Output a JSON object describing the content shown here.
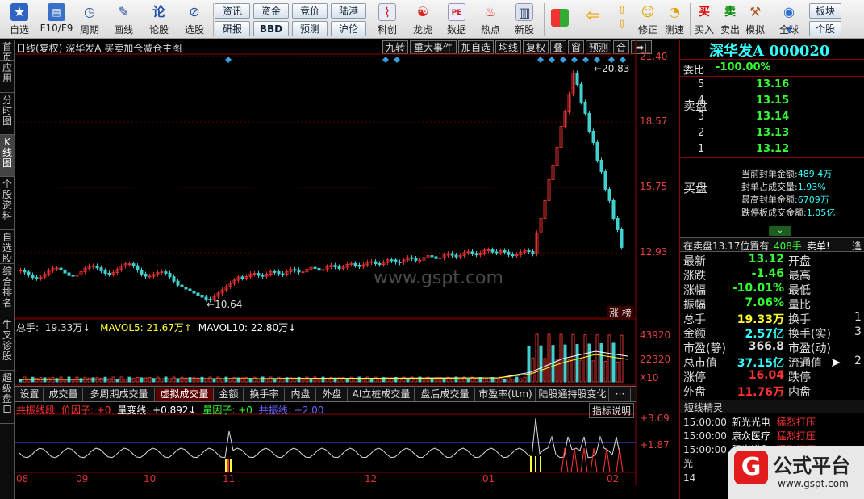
{
  "toolbar": {
    "buttons": [
      {
        "label": "自选",
        "icon": "star-icon"
      },
      {
        "label": "F10/F9",
        "icon": "f10-icon"
      },
      {
        "label": "周期",
        "icon": "clock-icon"
      },
      {
        "label": "画线",
        "icon": "pencil-icon"
      },
      {
        "label": "论股",
        "icon": "discuss-icon"
      },
      {
        "label": "选股",
        "icon": "stock-pick-icon"
      }
    ],
    "pills_top": [
      "资讯",
      "资金",
      "竞价",
      "陆港"
    ],
    "pills_bottom": [
      "研报",
      "BBD",
      "预测",
      "沪伦"
    ],
    "buttons2": [
      {
        "label": "科创",
        "icon": "kechuang-icon"
      },
      {
        "label": "龙虎",
        "icon": "dragon-tiger-icon"
      },
      {
        "label": "数据",
        "icon": "data-icon"
      },
      {
        "label": "热点",
        "icon": "hot-icon"
      },
      {
        "label": "新股",
        "icon": "ipo-icon"
      }
    ],
    "buttons3": [
      {
        "label": "",
        "icon": "grid-icon"
      },
      {
        "label": "",
        "icon": "back-arrow-icon"
      },
      {
        "label": "",
        "icon": "up-down-icon"
      },
      {
        "label": "修正",
        "icon": "fix-icon"
      },
      {
        "label": "测速",
        "icon": "speed-icon"
      },
      {
        "label": "买入",
        "icon": "buy-icon"
      },
      {
        "label": "卖出",
        "icon": "sell-icon"
      },
      {
        "label": "模拟",
        "icon": "hammer-icon"
      },
      {
        "label": "全球",
        "icon": "globe-icon"
      }
    ],
    "sector_pills": [
      "板块",
      "个股"
    ],
    "buy_glyph": "买",
    "sell_glyph": "卖"
  },
  "left_tabs": [
    {
      "label": "首页",
      "active": false
    },
    {
      "label": "应用",
      "active": false
    },
    {
      "label": "分时图",
      "active": false
    },
    {
      "label": "K线图",
      "active": true
    },
    {
      "label": "个股资料",
      "active": false
    },
    {
      "label": "自选股",
      "active": false
    },
    {
      "label": "综合排名",
      "active": false
    },
    {
      "label": "牛叉诊股",
      "active": false
    },
    {
      "label": "超级盘口",
      "active": false
    }
  ],
  "chart_header": {
    "period": "日线(复权)",
    "stock": "深华发A",
    "template": "买卖加仓减仓主图"
  },
  "top_tools": [
    "九转",
    "重大事件",
    "加自选",
    "均线",
    "复权",
    "叠",
    "窗",
    "预测",
    "合",
    "➡|"
  ],
  "price_axis": [
    "21.40",
    "18.57",
    "15.75",
    "12.93"
  ],
  "annotations": {
    "high": "20.83",
    "low": "10.64",
    "board": "涨 榜"
  },
  "volume_line": {
    "total_label": "总手:",
    "total_value": "19.33万↓",
    "ma5": "MAVOL5: 21.67万↑",
    "ma10": "MAVOL10: 22.80万↓"
  },
  "volume_axis": [
    "43920",
    "22320",
    "X10"
  ],
  "bottom_tabs": [
    "设置",
    "成交量",
    "多周期成交量",
    "虚拟成交量",
    "金额",
    "换手率",
    "内盘",
    "外盘",
    "AI立桩成交量",
    "盘后成交量",
    "市盈率(ttm)",
    "陆股通持股变化",
    "···"
  ],
  "active_bottom_tab": "虚拟成交量",
  "indicator_line": {
    "name": "共振线段",
    "price_factor": "价因子: +0",
    "vol_line": "量变线: +0.892↓",
    "vol_factor": "量因子: +0",
    "resonance": "共振线: +2.00"
  },
  "indicator_help": "指标说明",
  "indicator_axis": [
    "+3.69",
    "+1.87"
  ],
  "x_axis": [
    "08",
    "09",
    "10",
    "11",
    "12",
    "01",
    "02"
  ],
  "watermark": "www.gspt.com",
  "right_panel": {
    "name": "深华发A",
    "code": "000020",
    "weibi_label": "委比",
    "weibi_value": "-100.00%",
    "sell_label": "卖盘",
    "sell_rows": [
      {
        "level": "5",
        "price": "13.16"
      },
      {
        "level": "4",
        "price": "13.15"
      },
      {
        "level": "3",
        "price": "13.14"
      },
      {
        "level": "2",
        "price": "13.13"
      },
      {
        "level": "1",
        "price": "13.12"
      }
    ],
    "buy_label": "买盘",
    "seal_rows": [
      {
        "k": "当前封单金额:",
        "v": "489.4万"
      },
      {
        "k": "封单占成交量:",
        "v": "1.93%"
      },
      {
        "k": "最高封单金额:",
        "v": "6709万"
      },
      {
        "k": "跌停板成交金额:",
        "v": "1.05亿"
      }
    ],
    "queue": {
      "text": "在卖盘13.17位置有",
      "amount": "408手",
      "action": "卖单!",
      "extra": "逢"
    },
    "quote_rows": [
      {
        "k": "最新",
        "v": "13.12",
        "color": "#3f3",
        "k2": "开盘"
      },
      {
        "k": "涨跌",
        "v": "-1.46",
        "color": "#3f3",
        "k2": "最高"
      },
      {
        "k": "涨幅",
        "v": "-10.01%",
        "color": "#3f3",
        "k2": "最低"
      },
      {
        "k": "振幅",
        "v": "7.06%",
        "color": "#3f3",
        "k2": "量比"
      },
      {
        "k": "总手",
        "v": "19.33万",
        "color": "#ffff33",
        "k2": "换手"
      },
      {
        "k": "金额",
        "v": "2.57亿",
        "color": "#3ff",
        "k2": "换手(实)"
      },
      {
        "k": "市盈(静)",
        "v": "366.8",
        "color": "#ddd",
        "k2": "市盈(动)"
      },
      {
        "k": "总市值",
        "v": "37.15亿",
        "color": "#3ff",
        "k2": "流通值"
      },
      {
        "k": "涨停",
        "v": "16.04",
        "color": "#f33",
        "k2": "跌停"
      },
      {
        "k": "外盘",
        "v": "11.76万",
        "color": "#f33",
        "k2": "内盘"
      }
    ],
    "quote_right_partial": [
      "",
      "",
      "",
      "",
      "1",
      "3",
      "",
      "2",
      "",
      ""
    ],
    "fairy_title": "短线精灵",
    "fairy_rows": [
      {
        "t": "15:00:00",
        "n": "新光光电",
        "e": "猛烈打压"
      },
      {
        "t": "15:00:00",
        "n": "康众医疗",
        "e": "猛烈打压"
      },
      {
        "t": "15:00:00",
        "n": "阳光诺和",
        "e": "猛烈打压"
      }
    ],
    "fairy_bottom": [
      "光",
      "14"
    ]
  },
  "logo": {
    "mark": "G",
    "name": "公式平台",
    "url": "www.gspt.com"
  },
  "colors": {
    "up": "#e03030",
    "down": "#40d0d0",
    "ma_white": "#ffffff",
    "ma_yellow": "#ffff33",
    "accent_red": "#8b0000"
  }
}
